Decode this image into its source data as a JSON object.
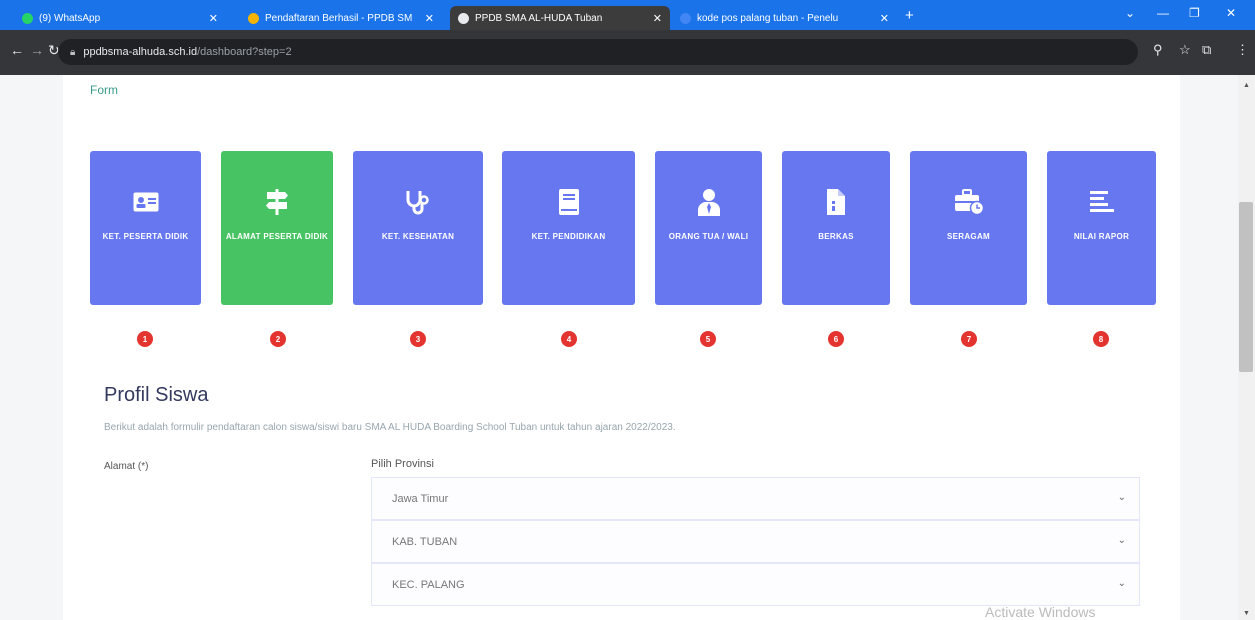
{
  "browser": {
    "tabs": [
      {
        "title": "(9) WhatsApp",
        "favicon_color": "#25d366"
      },
      {
        "title": "Pendaftaran Berhasil - PPDB SM",
        "favicon_color": "#f4b400"
      },
      {
        "title": "PPDB SMA AL-HUDA Tuban",
        "favicon_color": "#e8eaed"
      },
      {
        "title": "kode pos palang tuban - Penelu",
        "favicon_color": "#4285f4"
      }
    ],
    "url_domain": "ppdbsma-alhuda.sch.id",
    "url_path": "/dashboard?step=2"
  },
  "page": {
    "form_label": "Form",
    "tiles": [
      {
        "label": "KET. PESERTA DIDIK",
        "icon": "id-card-icon",
        "active": false
      },
      {
        "label": "ALAMAT PESERTA DIDIK",
        "icon": "signpost-icon",
        "active": true
      },
      {
        "label": "KET. KESEHATAN",
        "icon": "stethoscope-icon",
        "active": false
      },
      {
        "label": "KET. PENDIDIKAN",
        "icon": "book-icon",
        "active": false
      },
      {
        "label": "ORANG TUA / WALI",
        "icon": "user-tie-icon",
        "active": false
      },
      {
        "label": "BERKAS",
        "icon": "file-icon",
        "active": false
      },
      {
        "label": "SERAGAM",
        "icon": "briefcase-clock-icon",
        "active": false
      },
      {
        "label": "NILAI RAPOR",
        "icon": "align-left-icon",
        "active": false
      }
    ],
    "steps": [
      "1",
      "2",
      "3",
      "4",
      "5",
      "6",
      "7",
      "8"
    ],
    "section_title": "Profil Siswa",
    "section_desc": "Berikut adalah formulir pendaftaran calon siswa/siswi baru SMA AL HUDA Boarding School Tuban untuk tahun ajaran 2022/2023.",
    "address_label": "Alamat (*)",
    "province_label": "Pilih Provinsi",
    "selects": [
      "Jawa Timur",
      "KAB. TUBAN",
      "KEC. PALANG"
    ],
    "watermark": "Activate Windows"
  },
  "colors": {
    "tile": "#6777ef",
    "tile_active": "#47c363",
    "step": "#e3342f",
    "browser_accent": "#1a73e8"
  }
}
